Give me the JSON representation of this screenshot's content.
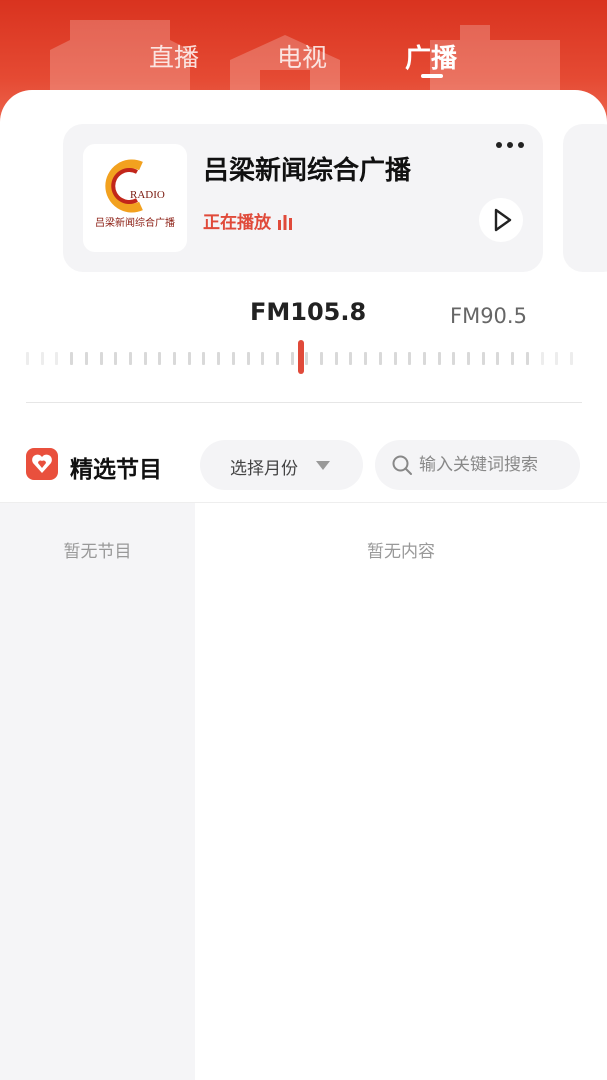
{
  "tabs": [
    {
      "label": "直播",
      "active": false
    },
    {
      "label": "电视",
      "active": false
    },
    {
      "label": "广播",
      "active": true
    }
  ],
  "station_card": {
    "logo_text": "RADIO",
    "logo_name": "吕梁新闻综合广播",
    "name": "吕梁新闻综合广播",
    "status": "正在播放",
    "more_icon": "more-dots-icon",
    "play_icon": "play-icon"
  },
  "frequency": {
    "current": "FM105.8",
    "next": "FM90.5"
  },
  "section": {
    "title": "精选节目",
    "icon": "heart-badge-icon",
    "month_select": "选择月份",
    "search_placeholder": "输入关键词搜索",
    "search_value": ""
  },
  "empty": {
    "programs": "暂无节目",
    "content": "暂无内容"
  },
  "colors": {
    "brand_red": "#e04a3a",
    "header_red": "#d9331f"
  }
}
